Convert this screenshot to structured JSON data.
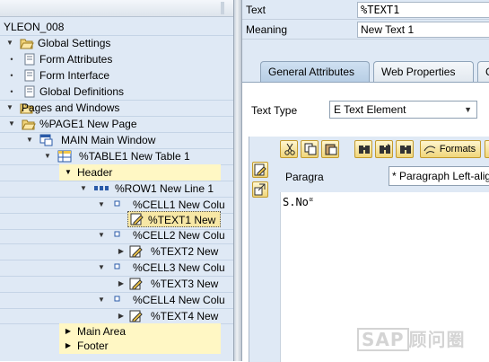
{
  "tree": {
    "root": "YLEON_008",
    "items": [
      {
        "label": "Global Settings",
        "icon": "folder-open-icon"
      },
      {
        "label": "Form Attributes",
        "icon": "form-icon"
      },
      {
        "label": "Form Interface",
        "icon": "form-icon"
      },
      {
        "label": "Global Definitions",
        "icon": "form-icon"
      },
      {
        "label": "Pages and Windows",
        "icon": "folder-open-icon"
      },
      {
        "label": "%PAGE1 New Page",
        "icon": "folder-open-icon"
      },
      {
        "label": "MAIN Main Window",
        "icon": "window-icon"
      },
      {
        "label": "%TABLE1 New Table 1",
        "icon": "table-icon"
      },
      {
        "label": "Header",
        "icon": ""
      },
      {
        "label": "%ROW1 New Line 1",
        "icon": "row-icon"
      },
      {
        "label": "%CELL1 New Colu",
        "icon": "cell-icon"
      },
      {
        "label": "%TEXT1 New",
        "icon": "text-edit-icon"
      },
      {
        "label": "%CELL2 New Colu",
        "icon": "cell-icon"
      },
      {
        "label": "%TEXT2 New",
        "icon": "text-edit-icon"
      },
      {
        "label": "%CELL3 New Colu",
        "icon": "cell-icon"
      },
      {
        "label": "%TEXT3 New",
        "icon": "text-edit-icon"
      },
      {
        "label": "%CELL4 New Colu",
        "icon": "cell-icon"
      },
      {
        "label": "%TEXT4 New",
        "icon": "text-edit-icon"
      },
      {
        "label": "Main Area",
        "icon": ""
      },
      {
        "label": "Footer",
        "icon": ""
      }
    ]
  },
  "details": {
    "text_label": "Text",
    "text_value": "%TEXT1",
    "meaning_label": "Meaning",
    "meaning_value": "New Text 1"
  },
  "tabs": [
    {
      "label": "General Attributes",
      "active": true
    },
    {
      "label": "Web Properties",
      "active": false
    },
    {
      "label": "C",
      "active": false
    }
  ],
  "general": {
    "text_type_label": "Text Type",
    "text_type_value": "E Text Element",
    "toolbar": {
      "formats_label": "Formats"
    },
    "paragraph_label": "Paragra",
    "paragraph_value": "* Paragraph Left-alig",
    "editor_content": "S.No"
  },
  "watermark": {
    "sap": "SAP",
    "chinese": "顾问圈"
  },
  "colors": {
    "panel_bg": "#dfe9f5",
    "highlight": "#fff7c4",
    "selected": "#f7e7a5",
    "button_gold": "#f0d67b"
  }
}
